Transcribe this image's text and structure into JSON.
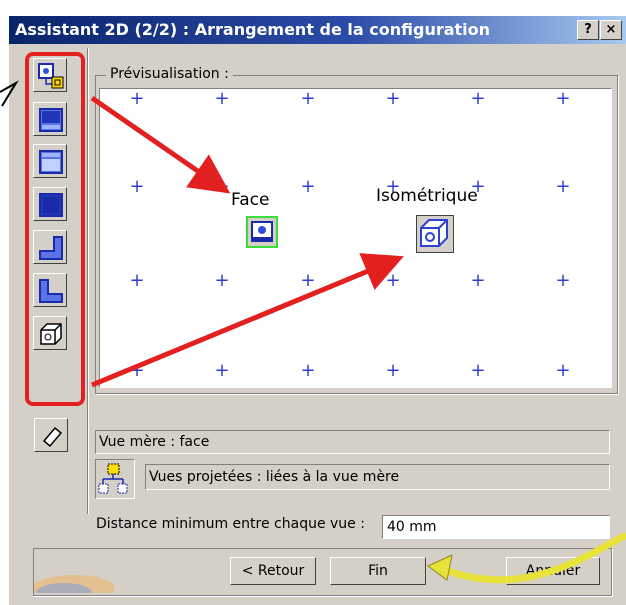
{
  "window": {
    "title": "Assistant 2D (2/2) : Arrangement de la configuration",
    "help_label": "?",
    "close_label": "×"
  },
  "preview": {
    "label": "Prévisualisation :",
    "views": [
      {
        "label": "Face",
        "icon": "front-view-icon"
      },
      {
        "label": "Isométrique",
        "icon": "isometric-view-icon"
      }
    ]
  },
  "toolbar": {
    "tools": [
      {
        "icon": "front-view-icon"
      },
      {
        "icon": "top-view-icon"
      },
      {
        "icon": "bottom-view-icon"
      },
      {
        "icon": "rear-view-icon"
      },
      {
        "icon": "left-view-icon"
      },
      {
        "icon": "right-view-icon"
      },
      {
        "icon": "isometric-view-icon"
      },
      {
        "icon": "eraser-icon"
      }
    ]
  },
  "info": {
    "parent_view": "Vue mère : face",
    "projected_views": "Vues projetées : liées à la vue mère"
  },
  "distance": {
    "label": "Distance minimum entre chaque vue :",
    "value": "40 mm"
  },
  "buttons": {
    "back": "< Retour",
    "finish": "Fin",
    "cancel": "Annuler"
  },
  "colors": {
    "title_bar": "#0a246a",
    "annotation_red": "#e32020",
    "annotation_yellow": "#e8e23a",
    "grid_plus": "#2f3fd0"
  }
}
